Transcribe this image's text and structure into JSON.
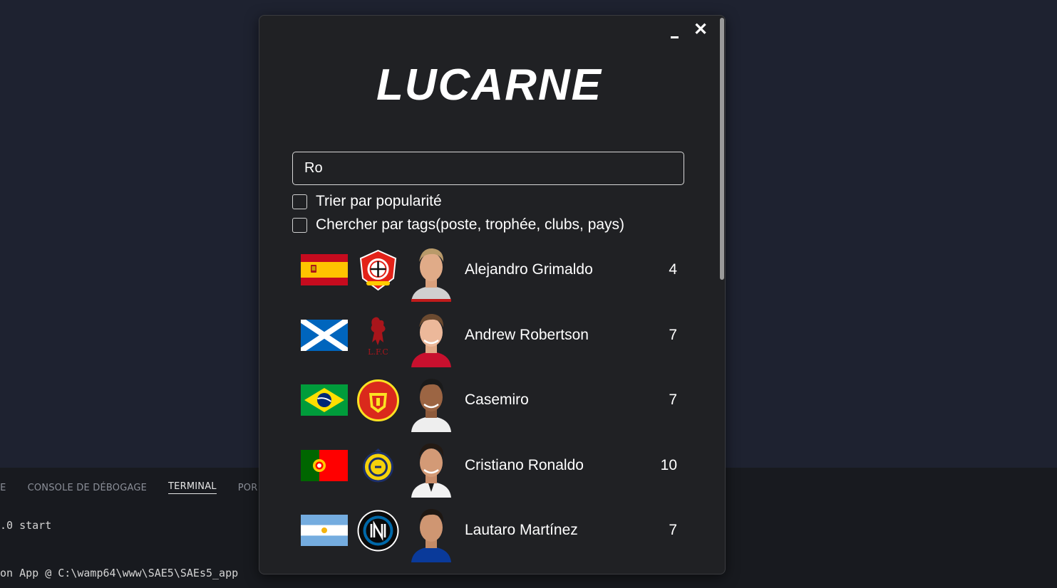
{
  "background": {
    "panel_tabs": [
      "TIE",
      "CONSOLE DE DÉBOGAGE",
      "TERMINAL",
      "POR"
    ],
    "terminal_lines": [
      ".0 start",
      "on App @ C:\\wamp64\\www\\SAE5\\SAEs5_app"
    ]
  },
  "app": {
    "logo": "LUCARNE",
    "minimize_icon": "minimize-icon",
    "close_label": "✕",
    "search": {
      "value": "Ro"
    },
    "options": [
      {
        "label": "Trier par popularité",
        "checked": false
      },
      {
        "label": "Chercher par tags(poste, trophée, clubs, pays)",
        "checked": false
      }
    ],
    "results": [
      {
        "flag": "spain-flag-icon",
        "club": "bayer-leverkusen-crest-icon",
        "name": "Alejandro Grimaldo",
        "count": "4"
      },
      {
        "flag": "scotland-flag-icon",
        "club": "liverpool-crest-icon",
        "name": "Andrew Robertson",
        "count": "7"
      },
      {
        "flag": "brazil-flag-icon",
        "club": "manchester-united-crest-icon",
        "name": "Casemiro",
        "count": "7"
      },
      {
        "flag": "portugal-flag-icon",
        "club": "al-nassr-crest-icon",
        "name": "Cristiano Ronaldo",
        "count": "10"
      },
      {
        "flag": "argentina-flag-icon",
        "club": "inter-milan-crest-icon",
        "name": "Lautaro Martínez",
        "count": "7"
      }
    ],
    "colors": {
      "window_bg": "#202124",
      "page_bg": "#1e2230",
      "text": "#ffffff"
    }
  }
}
